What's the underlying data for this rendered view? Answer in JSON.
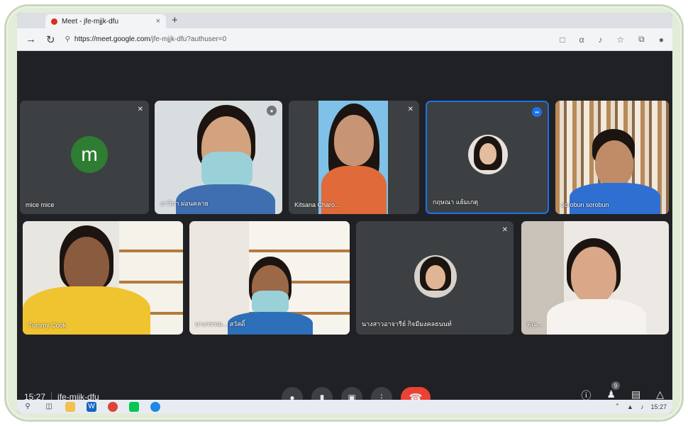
{
  "browser": {
    "tab_title": "Meet - jfe-mjjk-dfu",
    "tab_close": "×",
    "new_tab": "+",
    "url_host": "https://meet.google.com",
    "url_path": "/jfe-mjjk-dfu?authuser=0",
    "back_icon": "arrow-left-icon",
    "reload_icon": "reload-icon"
  },
  "participants": [
    {
      "name": "mice mice",
      "avatar_letter": "m",
      "muted": true
    },
    {
      "name": "ภาวิกา ผ่อนคลาย",
      "muted": false
    },
    {
      "name": "Kitsana Charo...",
      "muted": true
    },
    {
      "name": "กฤษณา แย้มเกตุ",
      "muted": false,
      "speaking": true
    },
    {
      "name": "sorobun sorobun",
      "muted": false
    },
    {
      "name": "Tummy Cook",
      "muted": false
    },
    {
      "name": "นางวรรณ... สวัสดิ์",
      "muted": false
    },
    {
      "name": "นางสาวอาจารีย์ กิจมีมงคลธนนท์",
      "muted": true
    },
    {
      "name": "คุณ...",
      "muted": false
    }
  ],
  "meeting": {
    "time": "15:27",
    "code": "jfe-mjjk-dfu",
    "people_count": "9"
  },
  "taskbar": {
    "clock": "15:27"
  },
  "colors": {
    "meet_bg": "#202124",
    "hangup": "#ea4335",
    "speaking_border": "#1a73e8",
    "frame": "#e2ecd8"
  }
}
